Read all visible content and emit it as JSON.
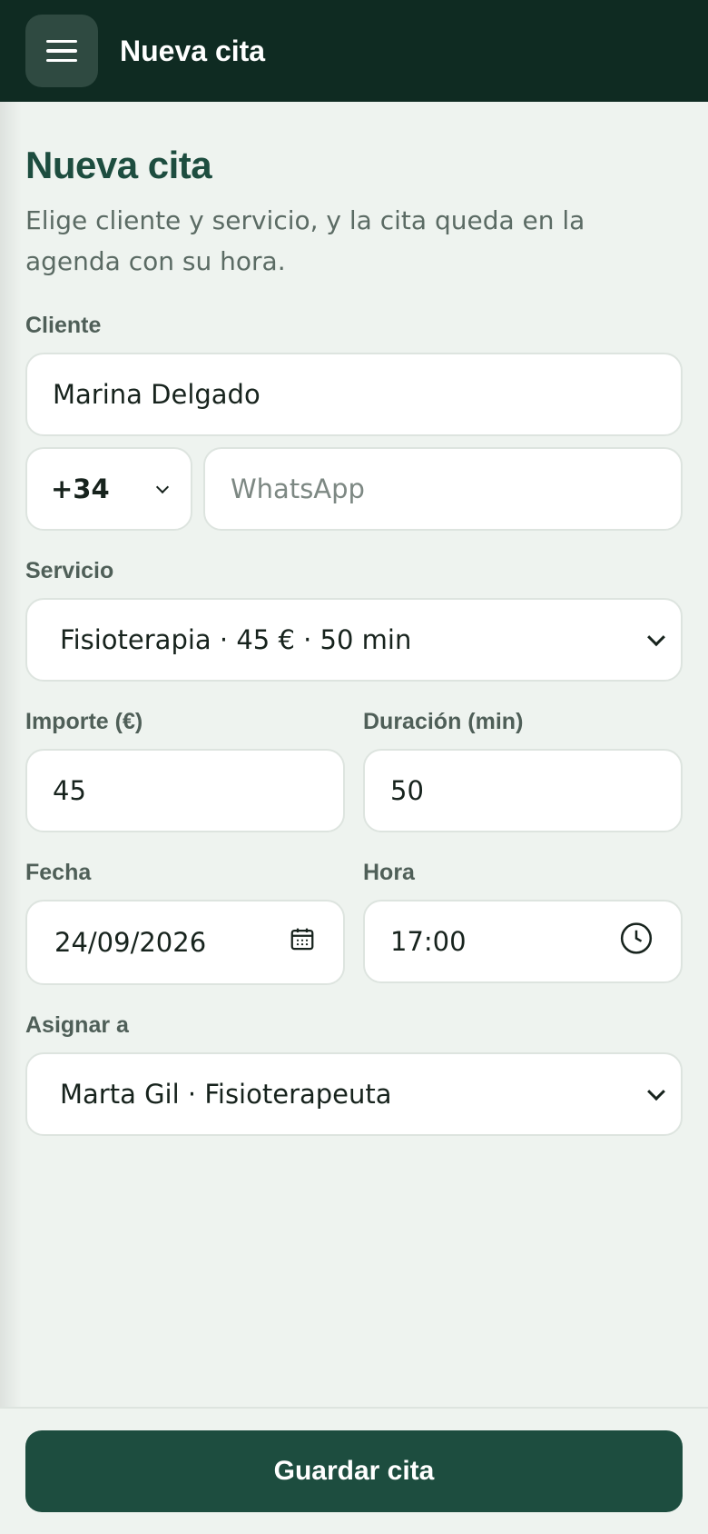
{
  "header": {
    "title": "Nueva cita",
    "menu_icon": "hamburger-menu-icon"
  },
  "page": {
    "title": "Nueva cita",
    "subtitle": "Elige cliente y servicio, y la cita queda en la agenda con su hora."
  },
  "form": {
    "client": {
      "label": "Cliente",
      "value": "Marina Delgado"
    },
    "phone": {
      "country_code": "+34",
      "placeholder": "WhatsApp",
      "value": ""
    },
    "service": {
      "label": "Servicio",
      "selected": "Fisioterapia · 45 € · 50 min"
    },
    "amount": {
      "label": "Importe (€)",
      "value": "45"
    },
    "duration": {
      "label": "Duración (min)",
      "value": "50"
    },
    "date": {
      "label": "Fecha",
      "value": "24/09/2026",
      "icon": "calendar-icon"
    },
    "time": {
      "label": "Hora",
      "value": "17:00",
      "icon": "clock-icon"
    },
    "assign": {
      "label": "Asignar a",
      "selected": "Marta Gil · Fisioterapeuta"
    }
  },
  "footer": {
    "save_label": "Guardar cita"
  },
  "colors": {
    "header_bg": "#0f2b22",
    "accent": "#1d4d3f",
    "page_bg": "#eef3ef"
  }
}
